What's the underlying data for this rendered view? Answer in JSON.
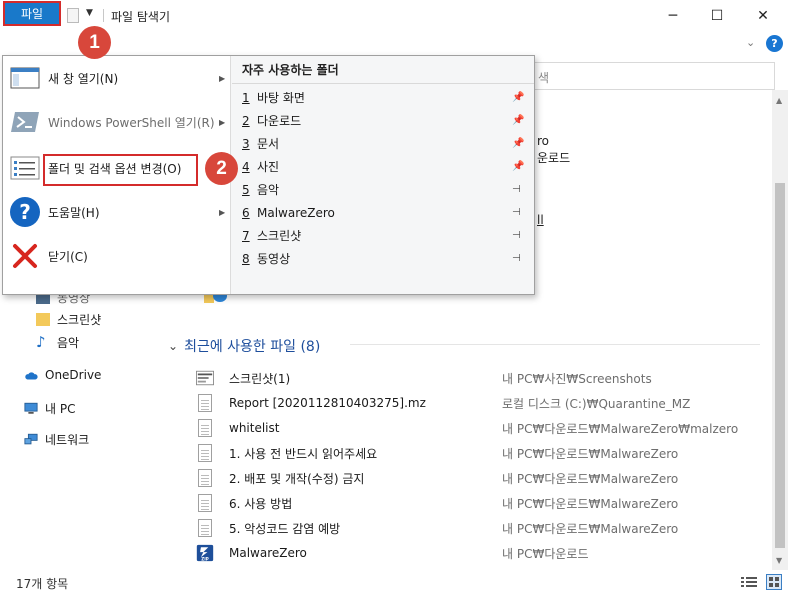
{
  "window": {
    "title": "파일 탐색기",
    "minimize": "─",
    "maximize": "☐",
    "close": "✕"
  },
  "ribbon": {
    "file_tab": "파일",
    "expand": "⌄",
    "help": "?"
  },
  "badges": [
    "1",
    "2"
  ],
  "address": {
    "search_partial": "색"
  },
  "file_menu": {
    "items": [
      {
        "label": "새 창 열기(N)",
        "icon": "new-window-icon",
        "has_submenu": true,
        "enabled": true
      },
      {
        "label": "Windows PowerShell 열기(R)",
        "icon": "powershell-icon",
        "has_submenu": true,
        "enabled": false
      },
      {
        "label": "폴더 및 검색 옵션 변경(O)",
        "icon": "folder-options-icon",
        "has_submenu": false,
        "enabled": true
      },
      {
        "label": "도움말(H)",
        "icon": "help-icon",
        "has_submenu": true,
        "enabled": true
      },
      {
        "label": "닫기(C)",
        "icon": "close-x-icon",
        "has_submenu": false,
        "enabled": true
      }
    ],
    "arrow": "▶",
    "frequent_header": "자주 사용하는 폴더",
    "frequent": [
      {
        "num": "1",
        "name": "바탕 화면",
        "pinned": true
      },
      {
        "num": "2",
        "name": "다운로드",
        "pinned": true
      },
      {
        "num": "3",
        "name": "문서",
        "pinned": true
      },
      {
        "num": "4",
        "name": "사진",
        "pinned": true
      },
      {
        "num": "5",
        "name": "음악",
        "pinned": false
      },
      {
        "num": "6",
        "name": "MalwareZero",
        "pinned": false
      },
      {
        "num": "7",
        "name": "스크린샷",
        "pinned": false
      },
      {
        "num": "8",
        "name": "동영상",
        "pinned": false
      }
    ],
    "pin_on": "📌",
    "pin_off": "⊣"
  },
  "behind_menu": {
    "partial1": "ro",
    "partial2": "운로드",
    "partial3": "ll"
  },
  "sidebar": {
    "partial_top": "동영상",
    "items": [
      {
        "label": "스크린샷",
        "icon": "folder-icon"
      },
      {
        "label": "음악",
        "icon": "music-icon"
      },
      {
        "label": "OneDrive",
        "icon": "cloud-icon"
      },
      {
        "label": "내 PC",
        "icon": "pc-icon"
      },
      {
        "label": "네트워크",
        "icon": "network-icon"
      }
    ]
  },
  "recent": {
    "heading": "최근에 사용한 파일 (8)",
    "chevron": "⌄",
    "files": [
      {
        "name": "스크린샷(1)",
        "path": "내 PC₩사진₩Screenshots",
        "icon": "image-file-icon"
      },
      {
        "name": "Report [2020112810403275].mz",
        "path": "로컬 디스크 (C:)₩Quarantine_MZ",
        "icon": "document-icon"
      },
      {
        "name": "whitelist",
        "path": "내 PC₩다운로드₩MalwareZero₩malzero",
        "icon": "document-icon"
      },
      {
        "name": "1. 사용 전 반드시 읽어주세요",
        "path": "내 PC₩다운로드₩MalwareZero",
        "icon": "document-icon"
      },
      {
        "name": "2. 배포 및 개작(수정) 금지",
        "path": "내 PC₩다운로드₩MalwareZero",
        "icon": "document-icon"
      },
      {
        "name": "6. 사용 방법",
        "path": "내 PC₩다운로드₩MalwareZero",
        "icon": "document-icon"
      },
      {
        "name": "5. 악성코드 감염 예방",
        "path": "내 PC₩다운로드₩MalwareZero",
        "icon": "document-icon"
      },
      {
        "name": "MalwareZero",
        "path": "내 PC₩다운로드",
        "icon": "zip-icon"
      }
    ]
  },
  "status": {
    "count": "17개 항목"
  },
  "colors": {
    "accent": "#1979ca",
    "highlight": "#d42b2b",
    "badge": "#d8473b"
  }
}
